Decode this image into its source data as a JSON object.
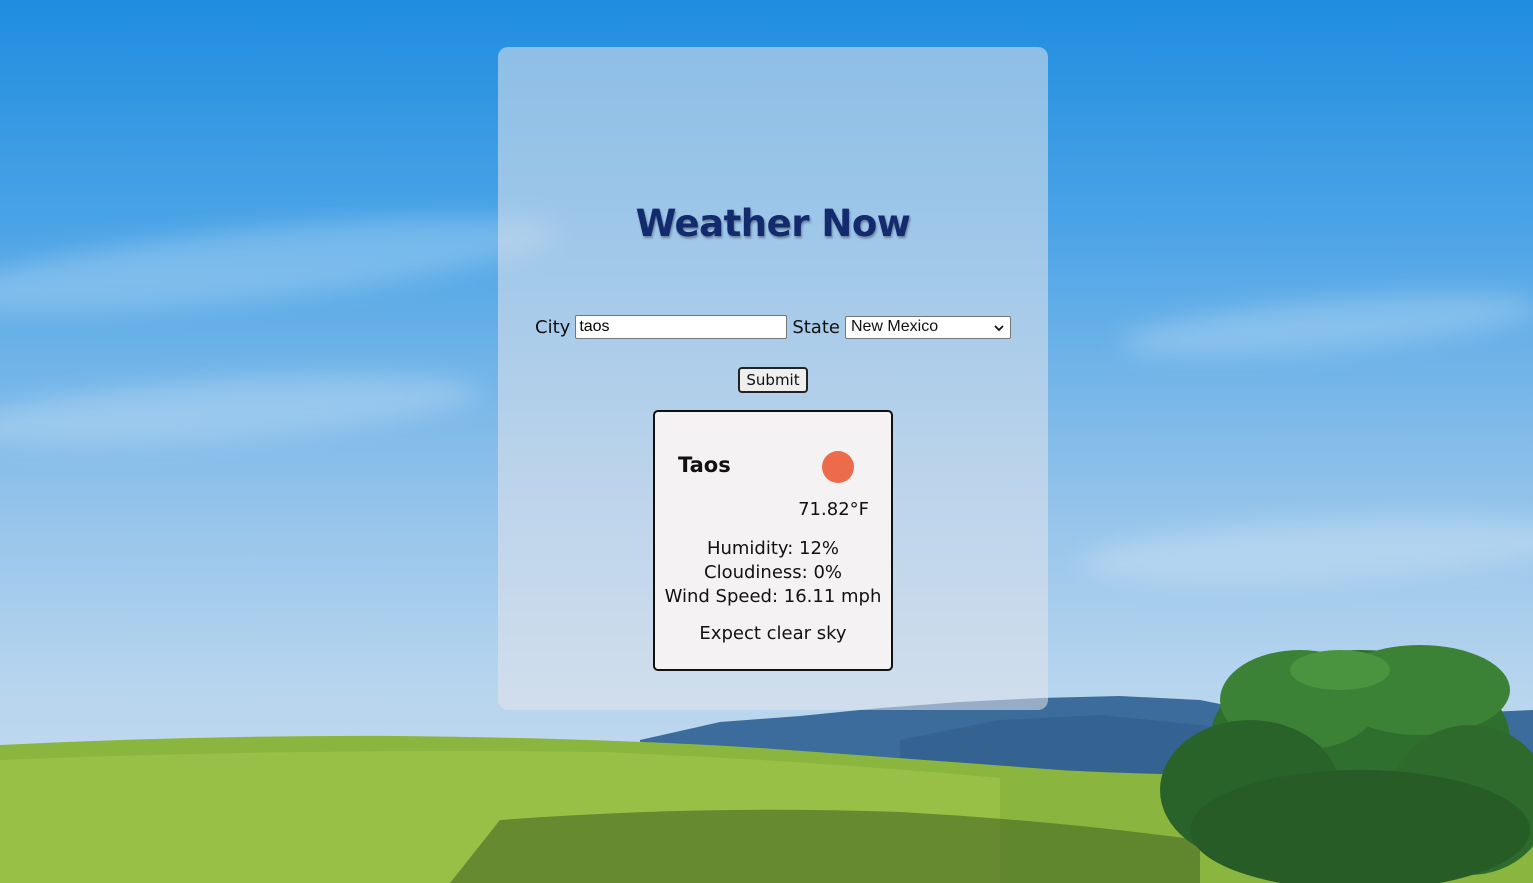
{
  "app": {
    "title": "Weather Now"
  },
  "search": {
    "city_label": "City",
    "city_value": "taos",
    "state_label": "State",
    "state_selected": "New Mexico",
    "submit_label": "Submit"
  },
  "weather": {
    "city": "Taos",
    "condition_icon": "sun-icon",
    "temperature": "71.82°F",
    "humidity": "Humidity: 12%",
    "cloudiness": "Cloudiness: 0%",
    "wind_speed": "Wind Speed: 16.11 mph",
    "forecast": "Expect clear sky"
  },
  "colors": {
    "title": "#142a6e",
    "sun": "#ec6b4b",
    "card_bg": "#f5f2f3"
  }
}
